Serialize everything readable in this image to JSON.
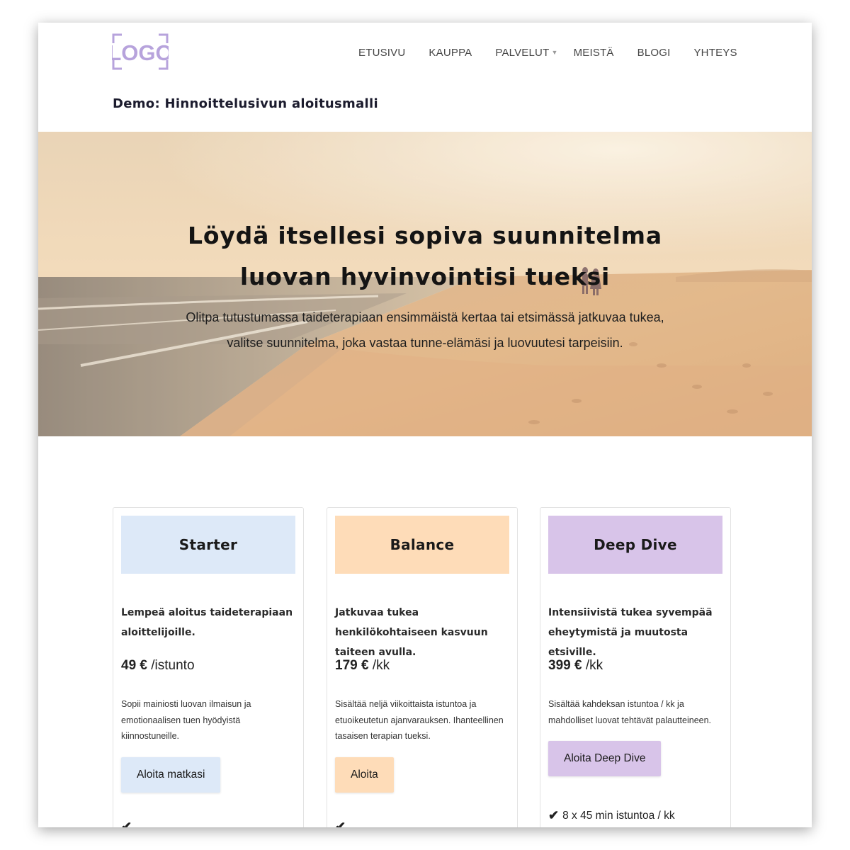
{
  "logo": {
    "text": "LOGO",
    "color": "#b7a3dc"
  },
  "nav": {
    "items": [
      {
        "label": "ETUSIVU",
        "has_dropdown": false
      },
      {
        "label": "KAUPPA",
        "has_dropdown": false
      },
      {
        "label": "PALVELUT",
        "has_dropdown": true
      },
      {
        "label": "MEISTÄ",
        "has_dropdown": false
      },
      {
        "label": "BLOGI",
        "has_dropdown": false
      },
      {
        "label": "YHTEYS",
        "has_dropdown": false
      }
    ]
  },
  "page": {
    "title": "Demo: Hinnoittelusivun aloitusmalli"
  },
  "hero": {
    "title_line1": "Löydä itsellesi sopiva suunnitelma",
    "title_line2": "luovan hyvinvointisi tueksi",
    "subtitle": "Olitpa tutustumassa taideterapiaan ensimmäistä kertaa tai etsimässä jatkuvaa tukea, valitse suunnitelma, joka vastaa tunne-elämäsi ja luovuutesi tarpeisiin."
  },
  "plans": [
    {
      "name": "Starter",
      "color": "#dde9f8",
      "description": "Lempeä aloitus taideterapiaan aloittelijoille.",
      "price_amount": "49 €",
      "price_unit": "/istunto",
      "note": "Sopii mainiosti luovan ilmaisun ja emotionaalisen tuen hyödyistä kiinnostuneille.",
      "button": "Aloita matkasi",
      "feature": ""
    },
    {
      "name": "Balance",
      "color": "#fedcb8",
      "description": "Jatkuvaa tukea henkilökohtaiseen kasvuun taiteen avulla.",
      "price_amount": "179 €",
      "price_unit": "/kk",
      "note": "Sisältää neljä viikoittaista istuntoa ja etuoikeutetun ajanvarauksen. Ihanteellinen tasaisen terapian tueksi.",
      "button": "Aloita",
      "feature": ""
    },
    {
      "name": "Deep Dive",
      "color": "#d8c4e9",
      "description": "Intensiivistä tukea syvempää eheytymistä ja muutosta etsiville.",
      "price_amount": "399 €",
      "price_unit": "/kk",
      "note": "Sisältää kahdeksan istuntoa / kk ja mahdolliset luovat tehtävät palautteineen.",
      "button": "Aloita Deep Dive",
      "feature": "8 x 45 min istuntoa / kk"
    }
  ],
  "icons": {
    "check": "check-icon",
    "caret": "chevron-down-icon"
  }
}
